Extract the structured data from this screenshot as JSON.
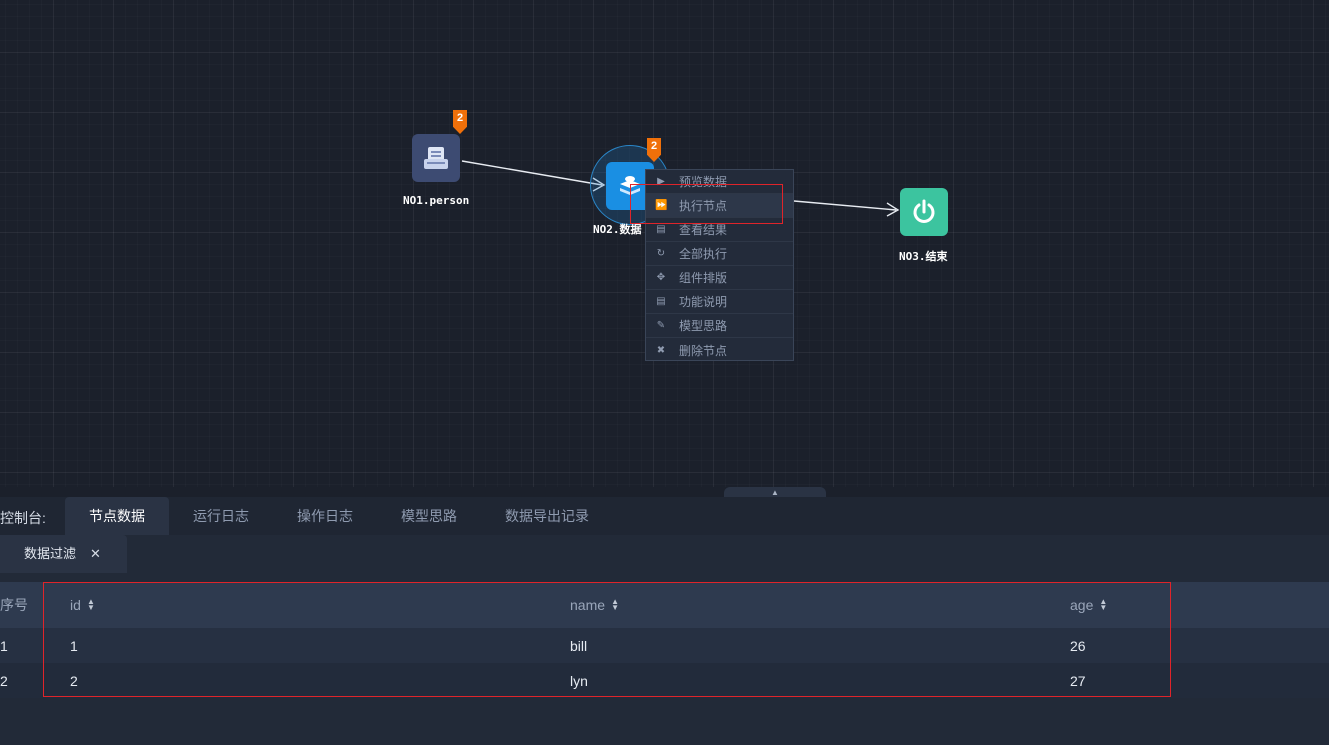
{
  "canvas": {
    "nodes": [
      {
        "label": "NO1.person",
        "badge": "2",
        "icon": "document-table-icon",
        "color": "#3d4b72"
      },
      {
        "label": "NO2.数据",
        "badge": "2",
        "icon": "data-filter-stack-icon",
        "color": "#1a8fe3"
      },
      {
        "label": "NO3.结束",
        "icon": "power-icon",
        "color": "#3cc49f"
      }
    ]
  },
  "context_menu": {
    "items": [
      {
        "label": "预览数据",
        "icon": "play-icon"
      },
      {
        "label": "执行节点",
        "icon": "fast-forward-icon"
      },
      {
        "label": "查看结果",
        "icon": "list-icon"
      },
      {
        "label": "全部执行",
        "icon": "refresh-icon"
      },
      {
        "label": "组件排版",
        "icon": "move-icon"
      },
      {
        "label": "功能说明",
        "icon": "list-icon"
      },
      {
        "label": "模型思路",
        "icon": "pencil-icon"
      },
      {
        "label": "删除节点",
        "icon": "close-icon"
      }
    ]
  },
  "console": {
    "label": "控制台:",
    "tabs": [
      "节点数据",
      "运行日志",
      "操作日志",
      "模型思路",
      "数据导出记录"
    ],
    "active_tab": "节点数据",
    "subtab": {
      "label": "数据过滤",
      "close": "✕"
    },
    "table": {
      "index_header": "序号",
      "columns": [
        "id",
        "name",
        "age"
      ],
      "rows": [
        {
          "index": "1",
          "id": "1",
          "name": "bill",
          "age": "26"
        },
        {
          "index": "2",
          "id": "2",
          "name": "lyn",
          "age": "27"
        }
      ]
    }
  },
  "colors": {
    "highlight_box": "#e0242a",
    "badge": "#f0700a",
    "canvas_bg": "#1b202b"
  }
}
